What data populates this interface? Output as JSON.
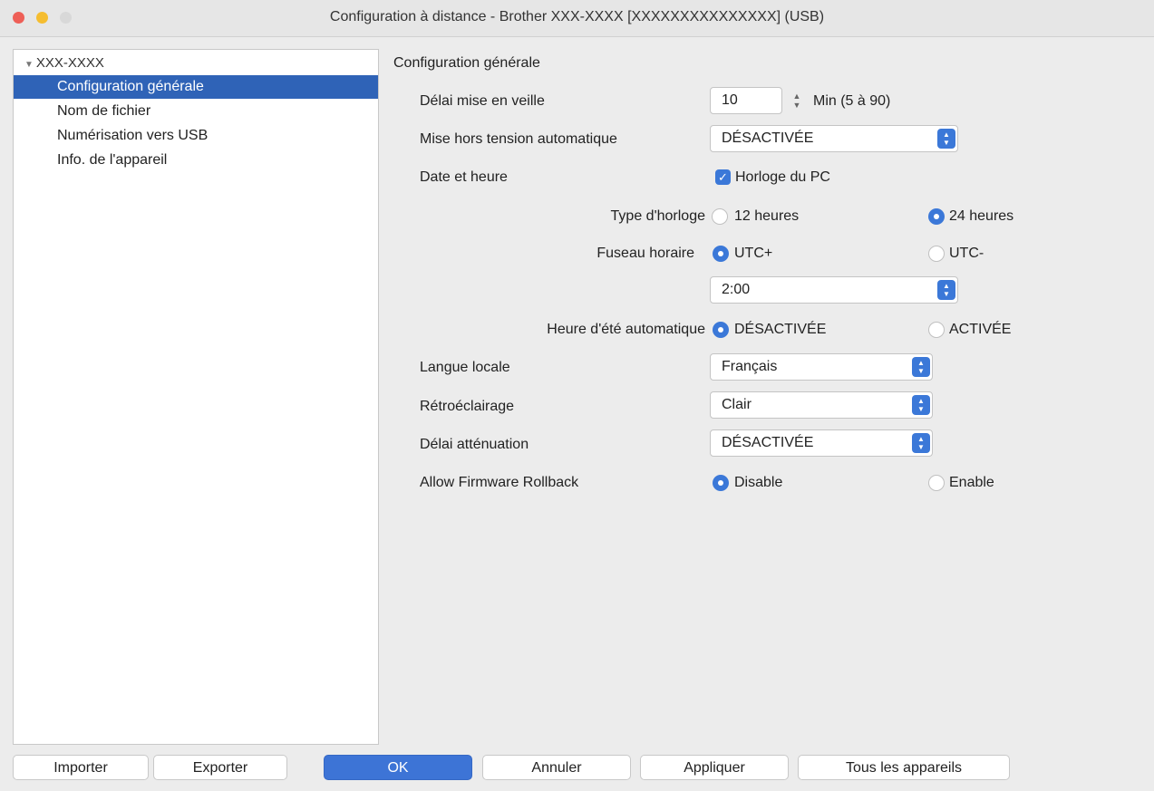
{
  "window": {
    "title": "Configuration à distance - Brother XXX-XXXX [XXXXXXXXXXXXXXX] (USB)"
  },
  "sidebar": {
    "root": "XXX-XXXX",
    "items": [
      {
        "label": "Configuration générale",
        "selected": true
      },
      {
        "label": "Nom de fichier",
        "selected": false
      },
      {
        "label": "Numérisation vers USB",
        "selected": false
      },
      {
        "label": "Info. de l'appareil",
        "selected": false
      }
    ]
  },
  "main": {
    "section_title": "Configuration générale",
    "sleep": {
      "label": "Délai mise en veille",
      "value": "10",
      "unit": "Min (5 à 90)"
    },
    "auto_power_off": {
      "label": "Mise hors tension automatique",
      "value": "DÉSACTIVÉE"
    },
    "date_time": {
      "label": "Date et heure",
      "pc_clock_label": "Horloge du PC",
      "pc_clock_checked": true
    },
    "clock_type": {
      "label": "Type d'horloge",
      "option1": "12 heures",
      "option2": "24 heures",
      "selected": "24 heures"
    },
    "time_zone": {
      "label": "Fuseau horaire",
      "option1": "UTC+",
      "option2": "UTC-",
      "selected": "UTC+",
      "offset": "2:00"
    },
    "dst": {
      "label": "Heure d'été automatique",
      "option1": "DÉSACTIVÉE",
      "option2": "ACTIVÉE",
      "selected": "DÉSACTIVÉE"
    },
    "language": {
      "label": "Langue locale",
      "value": "Français"
    },
    "backlight": {
      "label": "Rétroéclairage",
      "value": "Clair"
    },
    "dim_timer": {
      "label": "Délai atténuation",
      "value": "DÉSACTIVÉE"
    },
    "firmware_rollback": {
      "label": "Allow Firmware Rollback",
      "option1": "Disable",
      "option2": "Enable",
      "selected": "Disable"
    }
  },
  "buttons": {
    "import": "Importer",
    "export": "Exporter",
    "ok": "OK",
    "cancel": "Annuler",
    "apply": "Appliquer",
    "all_devices": "Tous les appareils"
  },
  "colors": {
    "accent": "#3b78d8",
    "selection": "#2f63b7"
  }
}
